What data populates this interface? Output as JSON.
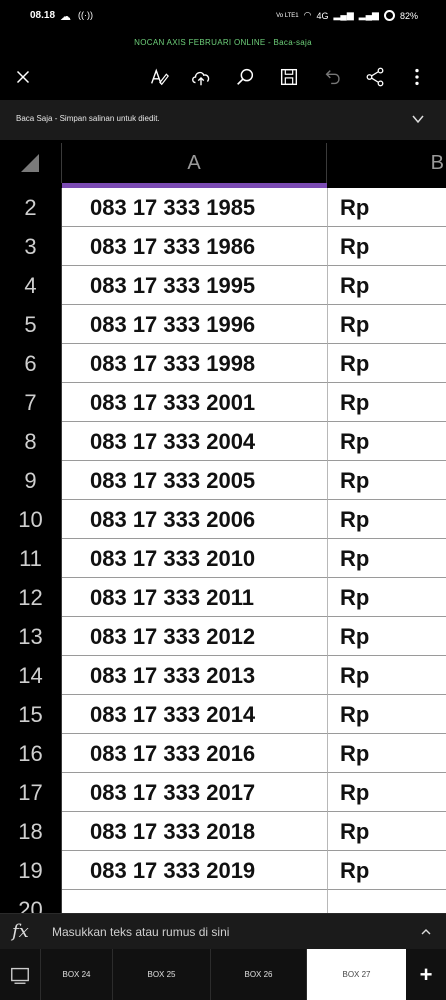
{
  "status_bar": {
    "time": "08.18",
    "volte": "Vo LTE1",
    "network": "4G",
    "battery": "82%"
  },
  "document": {
    "title": "NOCAN AXIS FEBRUARI ONLINE - Baca-saja"
  },
  "toolbar": {
    "icons": [
      "close-icon",
      "edit-icon",
      "cloud-upload-icon",
      "search-icon",
      "save-icon",
      "undo-icon",
      "share-icon",
      "more-icon"
    ]
  },
  "banner": {
    "text": "Baca Saja - Simpan salinan untuk diedit."
  },
  "grid": {
    "columns": [
      "A",
      "B"
    ],
    "rows": [
      {
        "num": "2",
        "a": "083 17 333 1985",
        "b": "Rp"
      },
      {
        "num": "3",
        "a": "083 17 333 1986",
        "b": "Rp"
      },
      {
        "num": "4",
        "a": "083 17 333 1995",
        "b": "Rp"
      },
      {
        "num": "5",
        "a": "083 17 333 1996",
        "b": "Rp"
      },
      {
        "num": "6",
        "a": "083 17 333 1998",
        "b": "Rp"
      },
      {
        "num": "7",
        "a": "083 17 333 2001",
        "b": "Rp"
      },
      {
        "num": "8",
        "a": "083 17 333 2004",
        "b": "Rp"
      },
      {
        "num": "9",
        "a": "083 17 333 2005",
        "b": "Rp"
      },
      {
        "num": "10",
        "a": "083 17 333 2006",
        "b": "Rp"
      },
      {
        "num": "11",
        "a": "083 17 333 2010",
        "b": "Rp"
      },
      {
        "num": "12",
        "a": "083 17 333 2011",
        "b": "Rp"
      },
      {
        "num": "13",
        "a": "083 17 333 2012",
        "b": "Rp"
      },
      {
        "num": "14",
        "a": "083 17 333 2013",
        "b": "Rp"
      },
      {
        "num": "15",
        "a": "083 17 333 2014",
        "b": "Rp"
      },
      {
        "num": "16",
        "a": "083 17 333 2016",
        "b": "Rp"
      },
      {
        "num": "17",
        "a": "083 17 333 2017",
        "b": "Rp"
      },
      {
        "num": "18",
        "a": "083 17 333 2018",
        "b": "Rp"
      },
      {
        "num": "19",
        "a": "083 17 333 2019",
        "b": "Rp"
      },
      {
        "num": "20",
        "a": "",
        "b": ""
      }
    ]
  },
  "formula_bar": {
    "fx": "fx",
    "placeholder": "Masukkan teks atau rumus di sini"
  },
  "sheet_tabs": {
    "tabs": [
      "BOX 24",
      "BOX 25",
      "BOX 26",
      "BOX 27"
    ],
    "active": "BOX 27",
    "add_label": "+"
  }
}
